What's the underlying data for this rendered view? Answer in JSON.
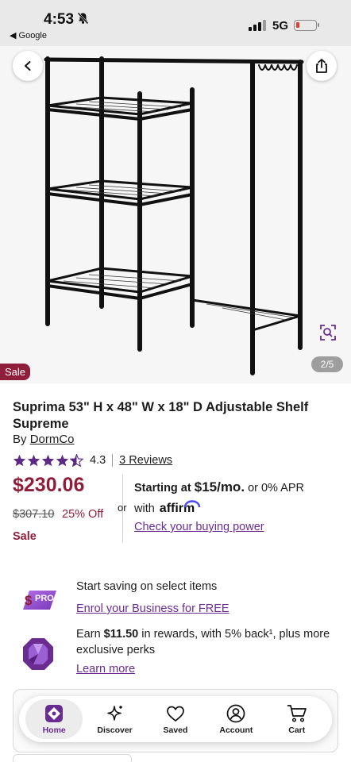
{
  "status_bar": {
    "time": "4:53",
    "back_app": "◀ Google",
    "network": "5G"
  },
  "gallery": {
    "sale_tag": "Sale",
    "page_counter": "2/5"
  },
  "product": {
    "title": "Suprima 53\" H x 48\" W x 18\" D Adjustable Shelf Supreme",
    "by_prefix": "By ",
    "brand": "DormCo",
    "rating": "4.3",
    "rating_value": 4.3,
    "reviews_link": "3 Reviews",
    "price": "$230.06",
    "was_price": "$307.10",
    "discount": "25% Off",
    "sale_label": "Sale"
  },
  "financing": {
    "or_text": "or",
    "starting_prefix": "Starting at ",
    "amount": "$15/mo.",
    "apr_text": " or 0% APR",
    "with_text": "with",
    "affirm_logo": "affirm",
    "check_link": "Check your buying power"
  },
  "promos": {
    "pro_badge": "PRO",
    "pro_headline": "Start saving on select items",
    "pro_link": "Enrol your Business for FREE",
    "rewards_prefix": "Earn ",
    "rewards_amount": "$11.50",
    "rewards_suffix": " in rewards, with 5% back¹, plus more exclusive perks",
    "rewards_link": "Learn more"
  },
  "nav": {
    "items": [
      {
        "label": "Home",
        "icon": "home-icon"
      },
      {
        "label": "Discover",
        "icon": "sparkle-icon"
      },
      {
        "label": "Saved",
        "icon": "heart-icon"
      },
      {
        "label": "Account",
        "icon": "user-icon"
      },
      {
        "label": "Cart",
        "icon": "cart-icon"
      }
    ],
    "active": "Home"
  },
  "colors": {
    "brand_purple": "#6b2c91",
    "sale_red": "#8f1e3a",
    "pro_gradient": "#9b4fd1",
    "battery_low": "#e23b30"
  }
}
